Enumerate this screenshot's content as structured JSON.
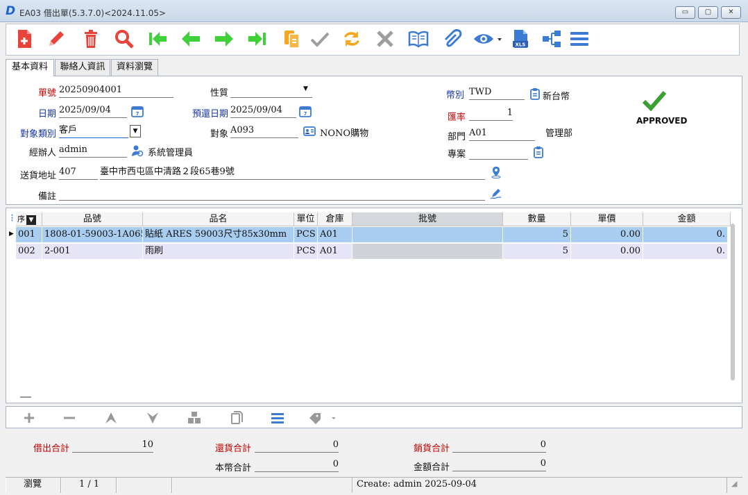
{
  "window": {
    "logo": "D",
    "title": "EA03 借出單(5.3.7.0)<2024.11.05>",
    "min": "▭",
    "restore": "▢",
    "close": "✕"
  },
  "tabs": [
    "基本資料",
    "聯絡人資訊",
    "資料瀏覽"
  ],
  "form": {
    "doc_no": {
      "label": "單號",
      "value": "20250904001"
    },
    "nature": {
      "label": "性質",
      "value": ""
    },
    "currency": {
      "label": "幣別",
      "value": "TWD",
      "name": "新台幣"
    },
    "date": {
      "label": "日期",
      "value": "2025/09/04"
    },
    "return_date": {
      "label": "預還日期",
      "value": "2025/09/04"
    },
    "rate": {
      "label": "匯率",
      "value": "1"
    },
    "target_type": {
      "label": "對象類別",
      "value": "客戶"
    },
    "target": {
      "label": "對象",
      "value": "A093",
      "name": "NONO購物"
    },
    "dept": {
      "label": "部門",
      "value": "A01",
      "name": "管理部"
    },
    "handler": {
      "label": "經辦人",
      "value": "admin",
      "name": "系統管理員"
    },
    "project": {
      "label": "專案",
      "value": ""
    },
    "address": {
      "label": "送貨地址",
      "zip": "407",
      "value": "臺中市西屯區中清路２段65巷9號"
    },
    "remark": {
      "label": "備註",
      "value": ""
    },
    "status": "APPROVED"
  },
  "grid": {
    "headers": [
      "序",
      "品號",
      "品名",
      "單位",
      "倉庫",
      "批號",
      "數量",
      "單價",
      "金額"
    ],
    "rows": [
      [
        "001",
        "1808-01-59003-1A065",
        "貼紙  ARES 59003尺寸85x30mm",
        "PCS",
        "A01",
        "",
        "5",
        "0.00",
        "0."
      ],
      [
        "002",
        "2-001",
        "雨刷",
        "PCS",
        "A01",
        "",
        "5",
        "0.00",
        "0."
      ]
    ]
  },
  "totals": {
    "lend_label": "借出合計",
    "lend": "10",
    "return_label": "還貨合計",
    "return": "0",
    "sales_label": "銷貨合計",
    "sales": "0",
    "local_label": "本幣合計",
    "local": "0",
    "amount_label": "金額合計",
    "amount": "0"
  },
  "statusbar": {
    "mode": "瀏覽",
    "page": "1 / 1",
    "create": "Create: admin 2025-09-04"
  },
  "colors": {
    "accent": "#1a66d0",
    "red_label": "#c00000",
    "blue_label": "#1433a6",
    "row_selected": "#a9cdf0",
    "approved": "#3aa035"
  }
}
